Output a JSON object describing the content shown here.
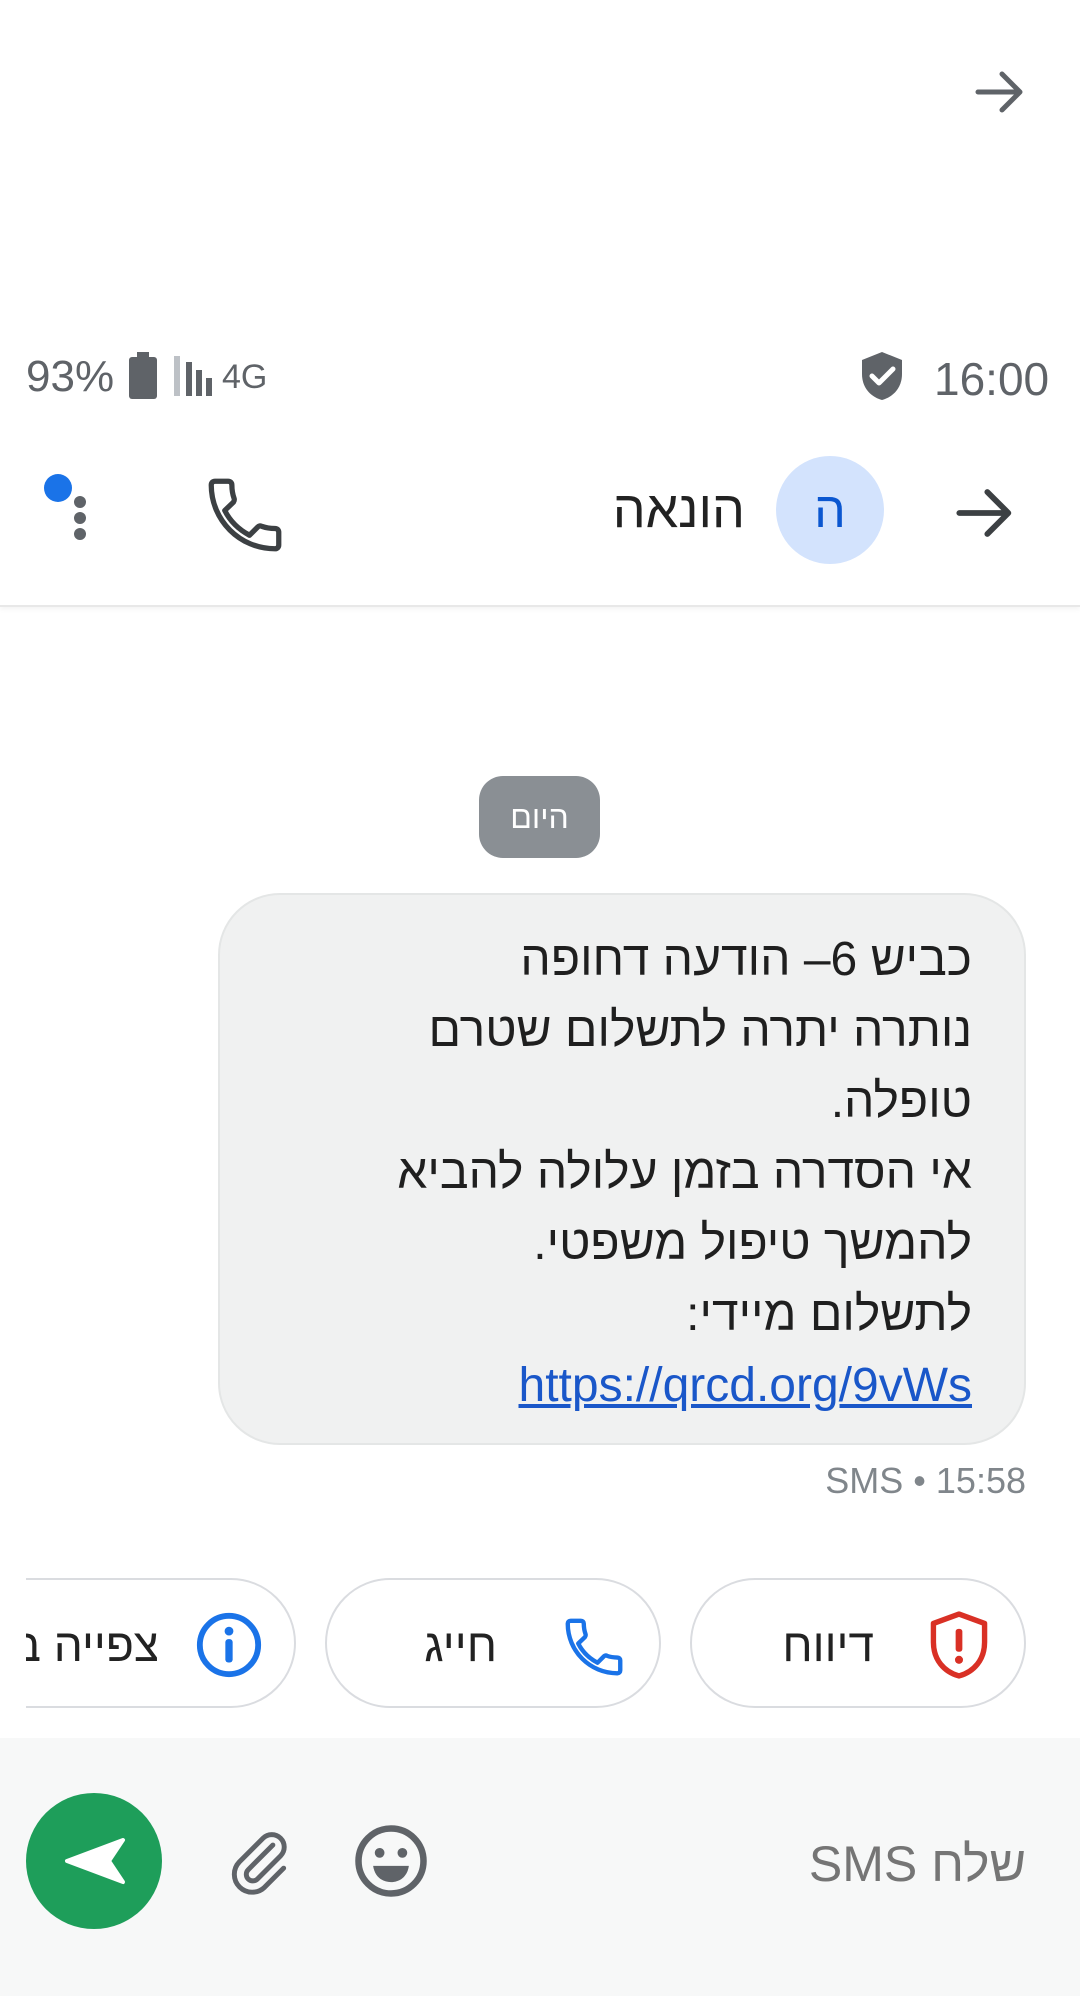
{
  "top_bar": {
    "arrow_icon": "arrow-right-icon"
  },
  "status_bar": {
    "battery_percent": "93%",
    "battery_icon": "battery-icon",
    "signal_icon": "signal-icon",
    "network": "4G",
    "shield_icon": "shield-check-icon",
    "time": "16:00"
  },
  "app_bar": {
    "contact_name": "הונאה",
    "avatar_letter": "ה",
    "back_icon": "arrow-right-icon",
    "call_icon": "phone-icon",
    "assistant_icon": "assistant-dots-icon"
  },
  "conversation": {
    "date_label": "היום",
    "message": {
      "lines": [
        "כביש 6– הודעה דחופה",
        "נותרה יתרה לתשלום שטרם",
        "טופלה.",
        "אי הסדרה בזמן עלולה להביא",
        "להמשך טיפול משפטי.",
        "לתשלום מיידי:"
      ],
      "link": "https://qrcd.org/9vWs",
      "meta": "SMS • 15:58"
    }
  },
  "suggestion_chips": [
    {
      "label": "דיווח",
      "icon": "shield-alert-icon"
    },
    {
      "label": "חייג",
      "icon": "phone-icon"
    },
    {
      "label": "צפייה ב",
      "icon": "info-icon"
    }
  ],
  "compose": {
    "placeholder": "שלח SMS",
    "send_icon": "send-icon",
    "attach_icon": "paperclip-icon",
    "emoji_icon": "emoji-icon"
  },
  "colors": {
    "accent_blue": "#1a73e8",
    "send_green": "#1e9e5a",
    "danger_red": "#d93025",
    "avatar_bg": "#d3e3fd"
  }
}
